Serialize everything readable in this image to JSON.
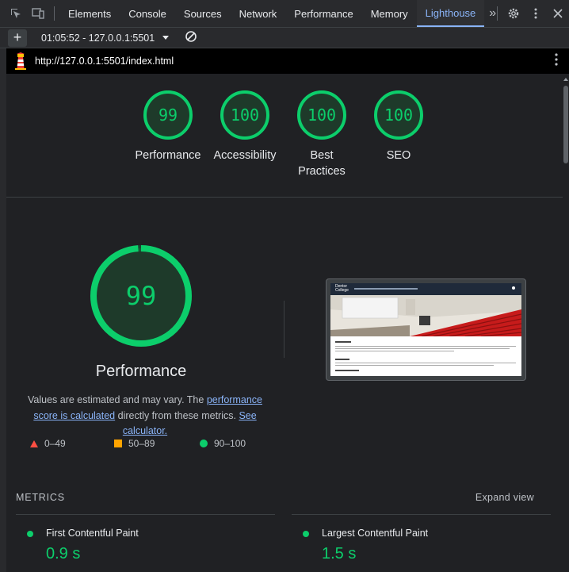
{
  "devtools": {
    "tabs": [
      "Elements",
      "Console",
      "Sources",
      "Network",
      "Performance",
      "Memory",
      "Lighthouse"
    ],
    "active_tab": "Lighthouse",
    "more_tabs": "»"
  },
  "toolbar": {
    "report_select": "01:05:52 - 127.0.0.1:5501",
    "add_label": "+"
  },
  "urlbar": {
    "url": "http://127.0.0.1:5501/index.html"
  },
  "scores": [
    {
      "value": "99",
      "label": "Performance",
      "score": 0.99
    },
    {
      "value": "100",
      "label": "Accessibility",
      "score": 1.0
    },
    {
      "value": "100",
      "label": "Best Practices",
      "score": 1.0
    },
    {
      "value": "100",
      "label": "SEO",
      "score": 1.0
    }
  ],
  "performance": {
    "score": "99",
    "score_fraction": 0.99,
    "title": "Performance",
    "desc_1": "Values are estimated and may vary. The ",
    "desc_link1": "performance score is calculated",
    "desc_2": " directly from these metrics. ",
    "desc_link2": "See calculator.",
    "legend": [
      {
        "range": "0–49",
        "shape": "triangle",
        "color": "#ff4e42"
      },
      {
        "range": "50–89",
        "shape": "square",
        "color": "#ffa400"
      },
      {
        "range": "90–100",
        "shape": "circle",
        "color": "#0cce6b"
      }
    ]
  },
  "metrics": {
    "header": "METRICS",
    "expand": "Expand view",
    "items": [
      {
        "name": "First Contentful Paint",
        "value": "0.9 s"
      },
      {
        "name": "Largest Contentful Paint",
        "value": "1.5 s"
      }
    ]
  },
  "screenshot": {
    "logo_line1": "Dentor",
    "logo_line2": "College"
  },
  "colors": {
    "pass": "#0cce6b",
    "accent": "#8ab4f8",
    "bg": "#202124"
  }
}
